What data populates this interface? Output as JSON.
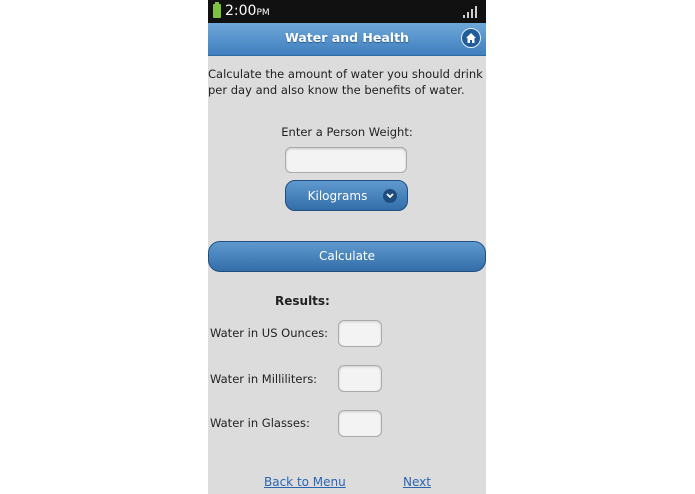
{
  "status": {
    "time": "2:00",
    "ampm": "PM"
  },
  "header": {
    "title": "Water and Health"
  },
  "intro": "Calculate the amount of water you should drink per day and also know the benefits of water.",
  "form": {
    "weight_label": "Enter a Person Weight:",
    "weight_value": "",
    "unit_selected": "Kilograms",
    "calculate_label": "Calculate"
  },
  "results": {
    "heading": "Results:",
    "items": [
      {
        "label": "Water in US Ounces:",
        "value": ""
      },
      {
        "label": "Water in Milliliters:",
        "value": ""
      },
      {
        "label": "Water in Glasses:",
        "value": ""
      }
    ]
  },
  "footer": {
    "back_label": "Back to Menu",
    "next_label": "Next"
  },
  "colors": {
    "accent": "#3f7fbf",
    "background": "#dcdcdc",
    "link": "#2a66b0"
  }
}
